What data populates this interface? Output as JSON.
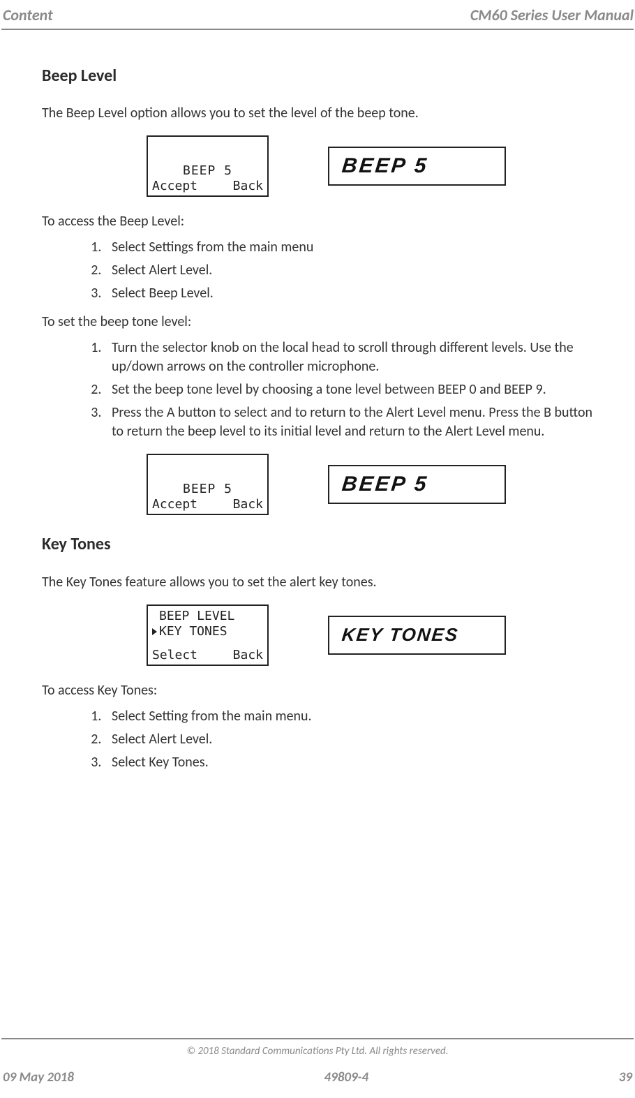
{
  "header": {
    "left": "Content",
    "right": "CM60 Series User Manual"
  },
  "sections": {
    "beep": {
      "title": "Beep Level",
      "intro": "The Beep Level option allows you to set the level of the beep tone.",
      "display1": {
        "lcd_main": "BEEP 5",
        "lcd_left": "Accept",
        "lcd_right": "Back",
        "seg": "BEEP 5"
      },
      "access_lead": "To access the Beep Level:",
      "access_steps": [
        "Select Settings from the main menu",
        "Select Alert Level.",
        "Select Beep Level."
      ],
      "set_lead": "To set the beep tone level:",
      "set_steps": [
        "Turn the selector knob on the local head to scroll through different levels. Use the up/down arrows on the controller microphone.",
        "Set the beep tone level by choosing a tone level between BEEP 0 and BEEP 9.",
        "Press the A button to select and to return to the Alert Level menu. Press the B button to return the beep level to its initial level and return to the Alert Level menu."
      ],
      "display2": {
        "lcd_main": "BEEP 5",
        "lcd_left": "Accept",
        "lcd_right": "Back",
        "seg": "BEEP 5"
      }
    },
    "keytones": {
      "title": "Key Tones",
      "intro": "The Key Tones feature allows you to set the alert key tones.",
      "display": {
        "lcd_line1": "BEEP LEVEL",
        "lcd_line2": "KEY TONES",
        "lcd_left": "Select",
        "lcd_right": "Back",
        "seg": "KEY TONES"
      },
      "access_lead": "To access Key Tones:",
      "access_steps": [
        "Select Setting from the main menu.",
        "Select Alert Level.",
        "Select Key Tones."
      ]
    }
  },
  "footer": {
    "copyright": "© 2018 Standard Communications Pty Ltd. All rights reserved.",
    "date": "09 May 2018",
    "docnum": "49809-4",
    "page": "39"
  }
}
